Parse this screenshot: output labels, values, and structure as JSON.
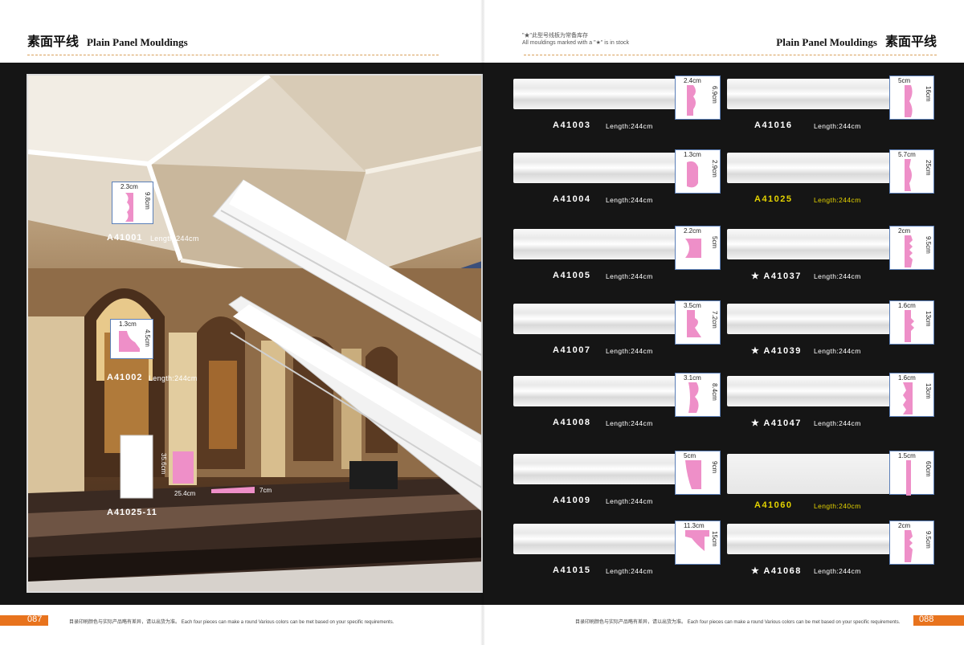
{
  "header": {
    "left_cn": "素面平线",
    "left_en": "Plain Panel Mouldings",
    "right_en": "Plain Panel Mouldings",
    "right_cn": "素面平线",
    "note_cn": "\"★\"此型号线板为常备库存",
    "note_en": "All mouldings marked with a \"★\" is in stock"
  },
  "scene_items": [
    {
      "code": "A41001",
      "length": "Length:244cm",
      "dim_w": "2.3cm",
      "dim_h": "9.8cm"
    },
    {
      "code": "A41002",
      "length": "Length:244cm",
      "dim_w": "1.3cm",
      "dim_h": "4.5cm"
    },
    {
      "code": "A41025-11",
      "dim_h": "35.6cm",
      "dim_w": "25.4cm",
      "dim_d": "7cm"
    }
  ],
  "products_left": [
    {
      "code": "A41003",
      "length": "Length:244cm",
      "dim_w": "2.4cm",
      "dim_h": "6.9cm"
    },
    {
      "code": "A41004",
      "length": "Length:244cm",
      "dim_w": "1.3cm",
      "dim_h": "2.9cm"
    },
    {
      "code": "A41005",
      "length": "Length:244cm",
      "dim_w": "2.2cm",
      "dim_h": "5cm"
    },
    {
      "code": "A41007",
      "length": "Length:244cm",
      "dim_w": "3.5cm",
      "dim_h": "7.2cm"
    },
    {
      "code": "A41008",
      "length": "Length:244cm",
      "dim_w": "3.1cm",
      "dim_h": "8.4cm"
    },
    {
      "code": "A41009",
      "length": "Length:244cm",
      "dim_w": "5cm",
      "dim_h": "9cm"
    },
    {
      "code": "A41015",
      "length": "Length:244cm",
      "dim_w": "11.3cm",
      "dim_h": "15cm"
    }
  ],
  "products_right": [
    {
      "star": "",
      "code": "A41016",
      "length": "Length:244cm",
      "dim_w": "5cm",
      "dim_h": "16cm",
      "highlight": false
    },
    {
      "star": "",
      "code": "A41025",
      "length": "Length:244cm",
      "dim_w": "5.7cm",
      "dim_h": "25cm",
      "highlight": true
    },
    {
      "star": "★",
      "code": "A41037",
      "length": "Length:244cm",
      "dim_w": "2cm",
      "dim_h": "9.5cm",
      "highlight": false
    },
    {
      "star": "★",
      "code": "A41039",
      "length": "Length:244cm",
      "dim_w": "1.6cm",
      "dim_h": "13cm",
      "highlight": false
    },
    {
      "star": "★",
      "code": "A41047",
      "length": "Length:244cm",
      "dim_w": "1.6cm",
      "dim_h": "13cm",
      "highlight": false
    },
    {
      "star": "",
      "code": "A41060",
      "length": "Length:240cm",
      "dim_w": "1.5cm",
      "dim_h": "60cm",
      "highlight": true
    },
    {
      "star": "★",
      "code": "A41068",
      "length": "Length:244cm",
      "dim_w": "2cm",
      "dim_h": "9.5cm",
      "highlight": false
    }
  ],
  "footer": {
    "left_page": "087",
    "right_page": "088",
    "note_left": "目录印刷颜色与实际产品略有差异，请以出货为准。   Each four pieces can make a round Various colors can be met based on your specific requirements.",
    "note_right": "目录印刷颜色与实际产品略有差异，请以出货为准。   Each four pieces can make a round Various colors can be met based on your specific requirements."
  },
  "colors": {
    "accent_orange": "#e8731d",
    "profile_pink": "#ee8fc8",
    "highlight_yellow": "#e4d300",
    "band": "#151515"
  }
}
